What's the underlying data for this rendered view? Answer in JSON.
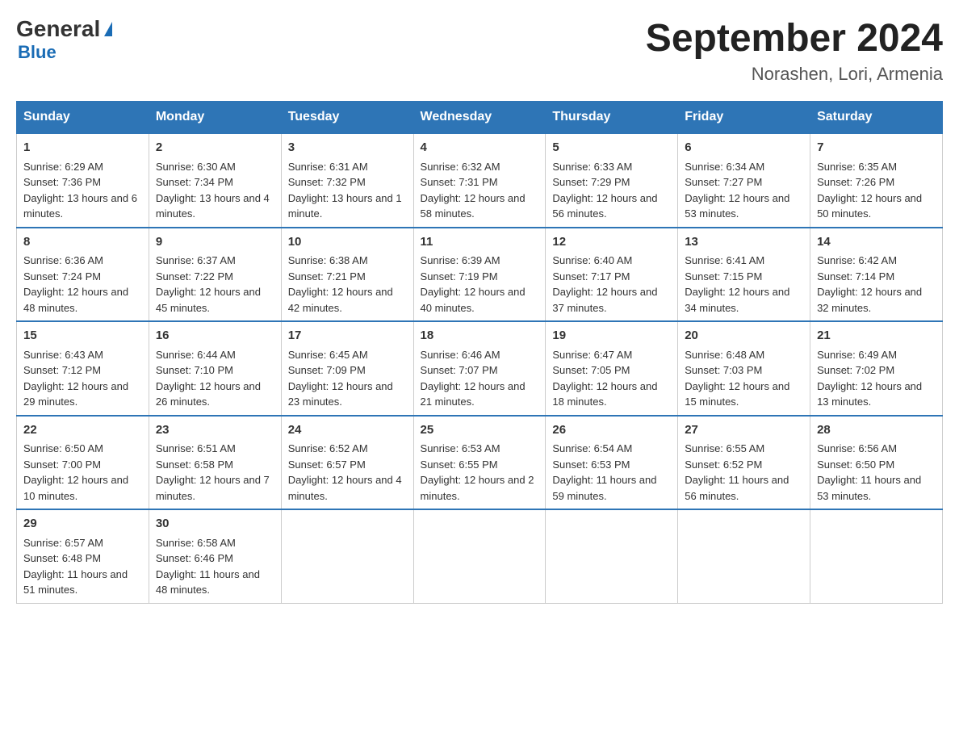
{
  "header": {
    "logo_general": "General",
    "logo_blue": "Blue",
    "title": "September 2024",
    "subtitle": "Norashen, Lori, Armenia"
  },
  "days_of_week": [
    "Sunday",
    "Monday",
    "Tuesday",
    "Wednesday",
    "Thursday",
    "Friday",
    "Saturday"
  ],
  "weeks": [
    [
      {
        "day": "1",
        "sunrise": "6:29 AM",
        "sunset": "7:36 PM",
        "daylight": "13 hours and 6 minutes."
      },
      {
        "day": "2",
        "sunrise": "6:30 AM",
        "sunset": "7:34 PM",
        "daylight": "13 hours and 4 minutes."
      },
      {
        "day": "3",
        "sunrise": "6:31 AM",
        "sunset": "7:32 PM",
        "daylight": "13 hours and 1 minute."
      },
      {
        "day": "4",
        "sunrise": "6:32 AM",
        "sunset": "7:31 PM",
        "daylight": "12 hours and 58 minutes."
      },
      {
        "day": "5",
        "sunrise": "6:33 AM",
        "sunset": "7:29 PM",
        "daylight": "12 hours and 56 minutes."
      },
      {
        "day": "6",
        "sunrise": "6:34 AM",
        "sunset": "7:27 PM",
        "daylight": "12 hours and 53 minutes."
      },
      {
        "day": "7",
        "sunrise": "6:35 AM",
        "sunset": "7:26 PM",
        "daylight": "12 hours and 50 minutes."
      }
    ],
    [
      {
        "day": "8",
        "sunrise": "6:36 AM",
        "sunset": "7:24 PM",
        "daylight": "12 hours and 48 minutes."
      },
      {
        "day": "9",
        "sunrise": "6:37 AM",
        "sunset": "7:22 PM",
        "daylight": "12 hours and 45 minutes."
      },
      {
        "day": "10",
        "sunrise": "6:38 AM",
        "sunset": "7:21 PM",
        "daylight": "12 hours and 42 minutes."
      },
      {
        "day": "11",
        "sunrise": "6:39 AM",
        "sunset": "7:19 PM",
        "daylight": "12 hours and 40 minutes."
      },
      {
        "day": "12",
        "sunrise": "6:40 AM",
        "sunset": "7:17 PM",
        "daylight": "12 hours and 37 minutes."
      },
      {
        "day": "13",
        "sunrise": "6:41 AM",
        "sunset": "7:15 PM",
        "daylight": "12 hours and 34 minutes."
      },
      {
        "day": "14",
        "sunrise": "6:42 AM",
        "sunset": "7:14 PM",
        "daylight": "12 hours and 32 minutes."
      }
    ],
    [
      {
        "day": "15",
        "sunrise": "6:43 AM",
        "sunset": "7:12 PM",
        "daylight": "12 hours and 29 minutes."
      },
      {
        "day": "16",
        "sunrise": "6:44 AM",
        "sunset": "7:10 PM",
        "daylight": "12 hours and 26 minutes."
      },
      {
        "day": "17",
        "sunrise": "6:45 AM",
        "sunset": "7:09 PM",
        "daylight": "12 hours and 23 minutes."
      },
      {
        "day": "18",
        "sunrise": "6:46 AM",
        "sunset": "7:07 PM",
        "daylight": "12 hours and 21 minutes."
      },
      {
        "day": "19",
        "sunrise": "6:47 AM",
        "sunset": "7:05 PM",
        "daylight": "12 hours and 18 minutes."
      },
      {
        "day": "20",
        "sunrise": "6:48 AM",
        "sunset": "7:03 PM",
        "daylight": "12 hours and 15 minutes."
      },
      {
        "day": "21",
        "sunrise": "6:49 AM",
        "sunset": "7:02 PM",
        "daylight": "12 hours and 13 minutes."
      }
    ],
    [
      {
        "day": "22",
        "sunrise": "6:50 AM",
        "sunset": "7:00 PM",
        "daylight": "12 hours and 10 minutes."
      },
      {
        "day": "23",
        "sunrise": "6:51 AM",
        "sunset": "6:58 PM",
        "daylight": "12 hours and 7 minutes."
      },
      {
        "day": "24",
        "sunrise": "6:52 AM",
        "sunset": "6:57 PM",
        "daylight": "12 hours and 4 minutes."
      },
      {
        "day": "25",
        "sunrise": "6:53 AM",
        "sunset": "6:55 PM",
        "daylight": "12 hours and 2 minutes."
      },
      {
        "day": "26",
        "sunrise": "6:54 AM",
        "sunset": "6:53 PM",
        "daylight": "11 hours and 59 minutes."
      },
      {
        "day": "27",
        "sunrise": "6:55 AM",
        "sunset": "6:52 PM",
        "daylight": "11 hours and 56 minutes."
      },
      {
        "day": "28",
        "sunrise": "6:56 AM",
        "sunset": "6:50 PM",
        "daylight": "11 hours and 53 minutes."
      }
    ],
    [
      {
        "day": "29",
        "sunrise": "6:57 AM",
        "sunset": "6:48 PM",
        "daylight": "11 hours and 51 minutes."
      },
      {
        "day": "30",
        "sunrise": "6:58 AM",
        "sunset": "6:46 PM",
        "daylight": "11 hours and 48 minutes."
      },
      null,
      null,
      null,
      null,
      null
    ]
  ],
  "labels": {
    "sunrise": "Sunrise:",
    "sunset": "Sunset:",
    "daylight": "Daylight:"
  }
}
